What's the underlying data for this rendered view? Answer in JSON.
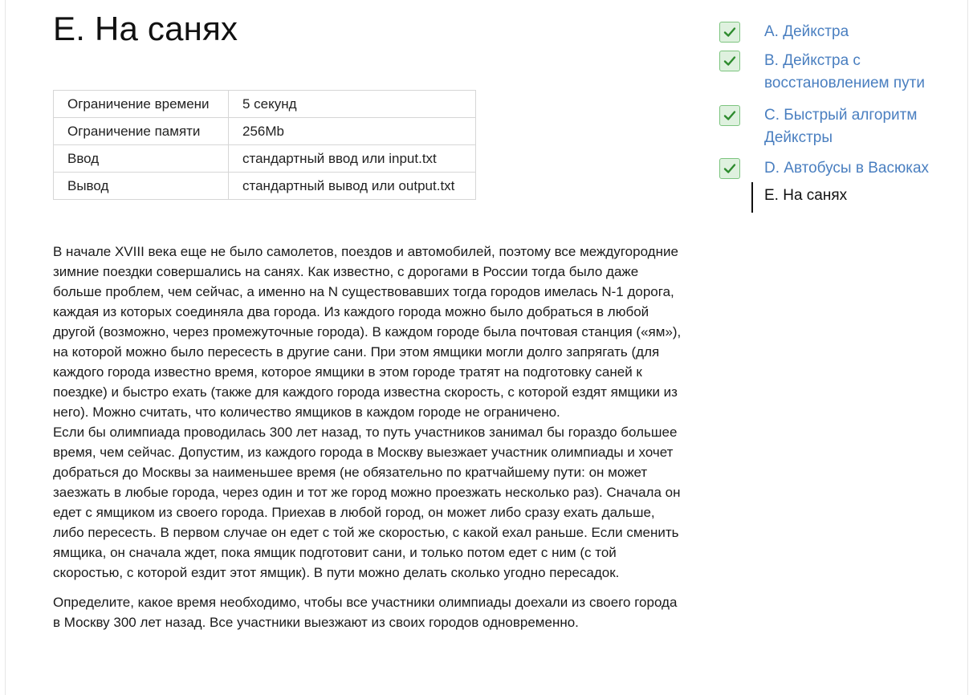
{
  "problem": {
    "title": "E. На санях"
  },
  "limits": [
    {
      "key": "Ограничение времени",
      "value": "5 секунд"
    },
    {
      "key": "Ограничение памяти",
      "value": "256Mb"
    },
    {
      "key": "Ввод",
      "value": "стандартный ввод или input.txt"
    },
    {
      "key": "Вывод",
      "value": "стандартный вывод или output.txt"
    }
  ],
  "statement": {
    "p1": "В начале XVIII века еще не было самолетов, поездов и автомобилей, поэтому все междугородние зимние поездки совершались на санях. Как известно, с дорогами в России тогда было даже больше проблем, чем сейчас, а именно на N существовавших тогда городов имелась N-1 дорога, каждая из которых соединяла два города. Из каждого города можно было добраться в любой другой (возможно, через промежуточные города). В каждом городе была почтовая станция («ям»), на которой можно было пересесть в другие сани. При этом ямщики могли долго запрягать (для каждого города известно время, которое ямщики в этом городе тратят на подготовку саней к поездке) и быстро ехать (также для каждого города известна скорость, с которой ездят ямщики из него). Можно считать, что количество ямщиков в каждом городе не ограничено.",
    "p2": "Если бы олимпиада проводилась 300 лет назад, то путь участников занимал бы гораздо большее время, чем сейчас. Допустим, из каждого города в Москву выезжает участник олимпиады и хочет добраться до Москвы за наименьшее время (не обязательно по кратчайшему пути: он может заезжать в любые города, через один и тот же город можно проезжать несколько раз). Сначала он едет с ямщиком из своего города. Приехав в любой город, он может либо сразу ехать дальше, либо пересесть. В первом случае он едет с той же скоростью, с какой ехал раньше. Если сменить ямщика, он сначала ждет, пока ямщик подготовит сани, и только потом едет с ним (с той скоростью, с которой ездит этот ямщик). В пути можно делать сколько угодно пересадок.",
    "p3": "Определите, какое время необходимо, чтобы все участники олимпиады доехали из своего города в Москву 300 лет назад. Все участники выезжают из своих городов одновременно."
  },
  "nav": {
    "items": [
      {
        "label": "A. Дейкстра",
        "solved": true,
        "icon": "check-icon"
      },
      {
        "label": "B. Дейкстра с восстановлением пути",
        "solved": true,
        "icon": "check-icon"
      },
      {
        "label": "C. Быстрый алгоритм Дейкстры",
        "solved": true,
        "icon": "check-icon"
      },
      {
        "label": "D. Автобусы в Васюках",
        "solved": true,
        "icon": "check-icon"
      }
    ],
    "current": "E. На санях"
  },
  "colors": {
    "link": "#4a7fc0",
    "check_bg": "#dff1df",
    "check_border": "#7cc47f",
    "check_mark": "#2e8b2e"
  }
}
